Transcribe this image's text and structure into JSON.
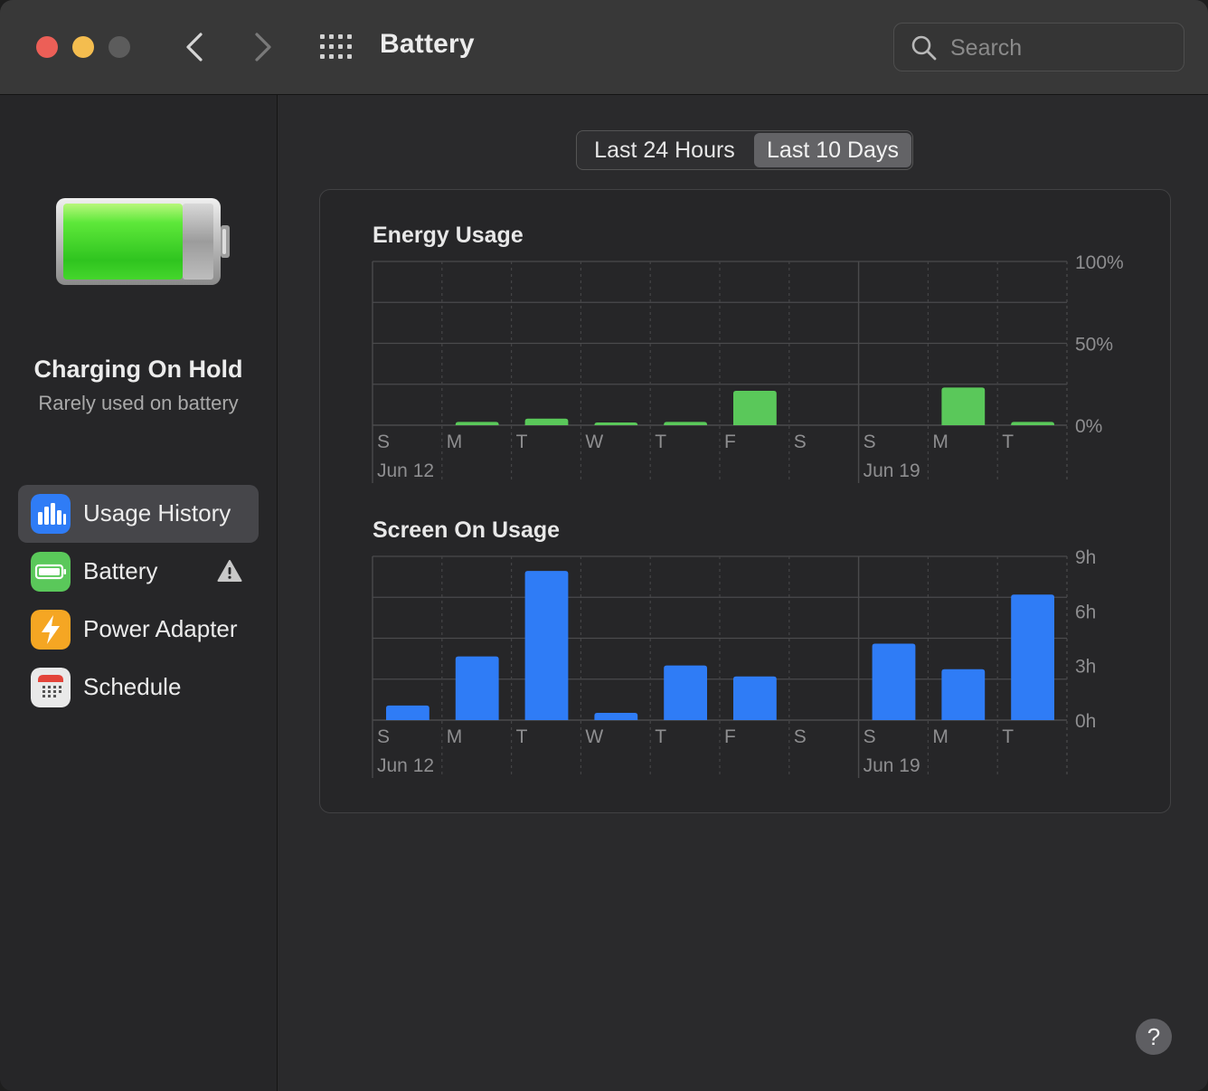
{
  "window": {
    "title": "Battery"
  },
  "search": {
    "placeholder": "Search"
  },
  "status": {
    "title": "Charging On Hold",
    "subtitle": "Rarely used on battery"
  },
  "sidebar": {
    "items": [
      {
        "label": "Usage History",
        "icon": "usage-history-icon",
        "color": "#2f7cf6",
        "selected": true
      },
      {
        "label": "Battery",
        "icon": "battery-icon",
        "color": "#5ac85a",
        "warning": true
      },
      {
        "label": "Power Adapter",
        "icon": "power-adapter-icon",
        "color": "#f5a623"
      },
      {
        "label": "Schedule",
        "icon": "calendar-icon",
        "color": "#e8e8e8"
      }
    ]
  },
  "tabs": [
    {
      "label": "Last 24 Hours",
      "selected": false
    },
    {
      "label": "Last 10 Days",
      "selected": true
    }
  ],
  "help": {
    "label": "?"
  },
  "chart_data": [
    {
      "type": "bar",
      "title": "Energy Usage",
      "categories": [
        "S",
        "M",
        "T",
        "W",
        "T",
        "F",
        "S",
        "S",
        "M",
        "T"
      ],
      "date_labels": [
        "Jun 12",
        "",
        "",
        "",
        "",
        "",
        "",
        "Jun 19",
        "",
        ""
      ],
      "values": [
        0,
        2,
        4,
        1,
        2,
        21,
        0,
        0,
        23,
        2
      ],
      "ylim": [
        0,
        100
      ],
      "yticks": [
        "100%",
        "50%",
        "0%"
      ],
      "color": "#5ac85a",
      "grid": true
    },
    {
      "type": "bar",
      "title": "Screen On Usage",
      "categories": [
        "S",
        "M",
        "T",
        "W",
        "T",
        "F",
        "S",
        "S",
        "M",
        "T"
      ],
      "date_labels": [
        "Jun 12",
        "",
        "",
        "",
        "",
        "",
        "",
        "Jun 19",
        "",
        ""
      ],
      "values": [
        0.8,
        3.5,
        8.2,
        0.4,
        3.0,
        2.4,
        0,
        4.2,
        2.8,
        6.9
      ],
      "ylim": [
        0,
        9
      ],
      "yticks": [
        "9h",
        "6h",
        "3h",
        "0h"
      ],
      "color": "#2f7cf6",
      "grid": true
    }
  ]
}
